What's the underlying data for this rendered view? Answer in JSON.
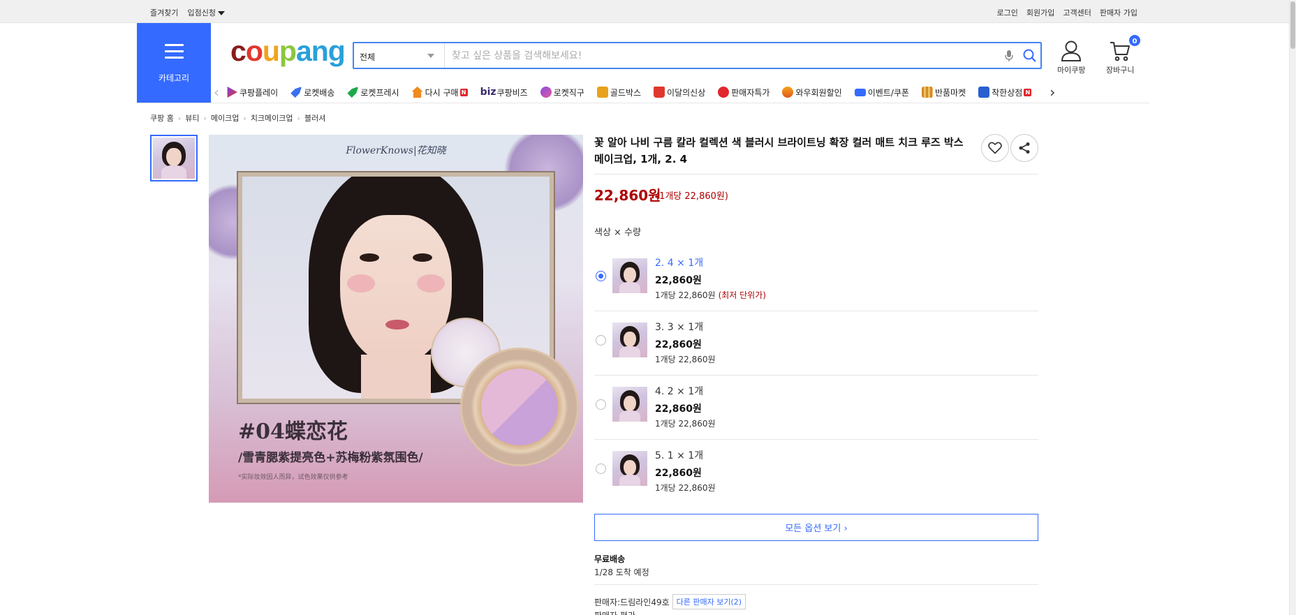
{
  "topbar": {
    "left": [
      "즐겨찾기",
      "입점신청"
    ],
    "right": [
      "로그인",
      "회원가입",
      "고객센터",
      "판매자 가입"
    ]
  },
  "header": {
    "category_label": "카테고리",
    "logo": [
      "c",
      "o",
      "u",
      "p",
      "ang"
    ],
    "search_scope": "전체",
    "search_placeholder": "찾고 싶은 상품을 검색해보세요!",
    "my_label": "마이쿠팡",
    "cart_label": "장바구니",
    "cart_count": "0",
    "accent": "#346aff"
  },
  "nav": {
    "items": [
      {
        "label": "쿠팡플레이",
        "icon": "play-icon",
        "color": "#7b3fe4"
      },
      {
        "label": "로켓배송",
        "icon": "rocket-icon",
        "color": "#3a6ff0"
      },
      {
        "label": "로켓프레시",
        "icon": "rocket-fresh-icon",
        "color": "#1ea84a"
      },
      {
        "label": "다시 구매",
        "icon": "home-icon",
        "color": "#f08a1c",
        "badge": "N"
      },
      {
        "label": "쿠팡비즈",
        "prefix": "biz",
        "icon": "biz-icon"
      },
      {
        "label": "로켓직구",
        "icon": "global-icon",
        "color": "#8a4ce0"
      },
      {
        "label": "골드박스",
        "icon": "gift-icon",
        "color": "#e8a21c"
      },
      {
        "label": "이달의신상",
        "icon": "bag-icon",
        "color": "#e0382e"
      },
      {
        "label": "판매자특가",
        "icon": "percent-icon",
        "color": "#e0282e"
      },
      {
        "label": "와우회원할인",
        "icon": "wow-icon",
        "color": "#e05a1c"
      },
      {
        "label": "이벤트/쿠폰",
        "icon": "coupon-icon",
        "color": "#346aff"
      },
      {
        "label": "반품마켓",
        "icon": "market-icon",
        "color": "#d08a2c"
      },
      {
        "label": "착한상점",
        "icon": "shop-icon",
        "color": "#2a5fd0",
        "badge": "N"
      }
    ]
  },
  "breadcrumb": [
    "쿠팡 홈",
    "뷰티",
    "메이크업",
    "치크메이크업",
    "블러셔"
  ],
  "image": {
    "brand": "FlowerKnows|花知晓",
    "title": "#04蝶恋花",
    "subtitle": "/雪青腮紫提亮色+苏梅粉紫氛围色/",
    "note": "*实际妆效因人而异，试色效果仅供参考"
  },
  "product": {
    "title": "꽃 알아 나비 구름 칼라 컬렉션 색 블러시 브라이트닝 확장 컬러 매트 치크 루즈 박스 메이크업, 1개, 2. 4",
    "price": "22,860원",
    "price_unit": "(1개당 22,860원)",
    "option_label": "색상 × 수량",
    "options": [
      {
        "name": "2. 4 × 1개",
        "price": "22,860원",
        "per": "1개당 22,860원",
        "note": "(최저 단위가)",
        "selected": true
      },
      {
        "name": "3. 3 × 1개",
        "price": "22,860원",
        "per": "1개당 22,860원",
        "note": "",
        "selected": false
      },
      {
        "name": "4. 2 × 1개",
        "price": "22,860원",
        "per": "1개당 22,860원",
        "note": "",
        "selected": false
      },
      {
        "name": "5. 1 × 1개",
        "price": "22,860원",
        "per": "1개당 22,860원",
        "note": "",
        "selected": false
      }
    ],
    "all_options": "모든 옵션 보기 ›",
    "shipping_title": "무료배송",
    "shipping_date": "1/28 도착 예정",
    "seller": "판매자:드림라인49호",
    "other_sellers": "다른 판매자 보기",
    "other_count": "(2)",
    "seller_rating": "판매자 평가"
  }
}
